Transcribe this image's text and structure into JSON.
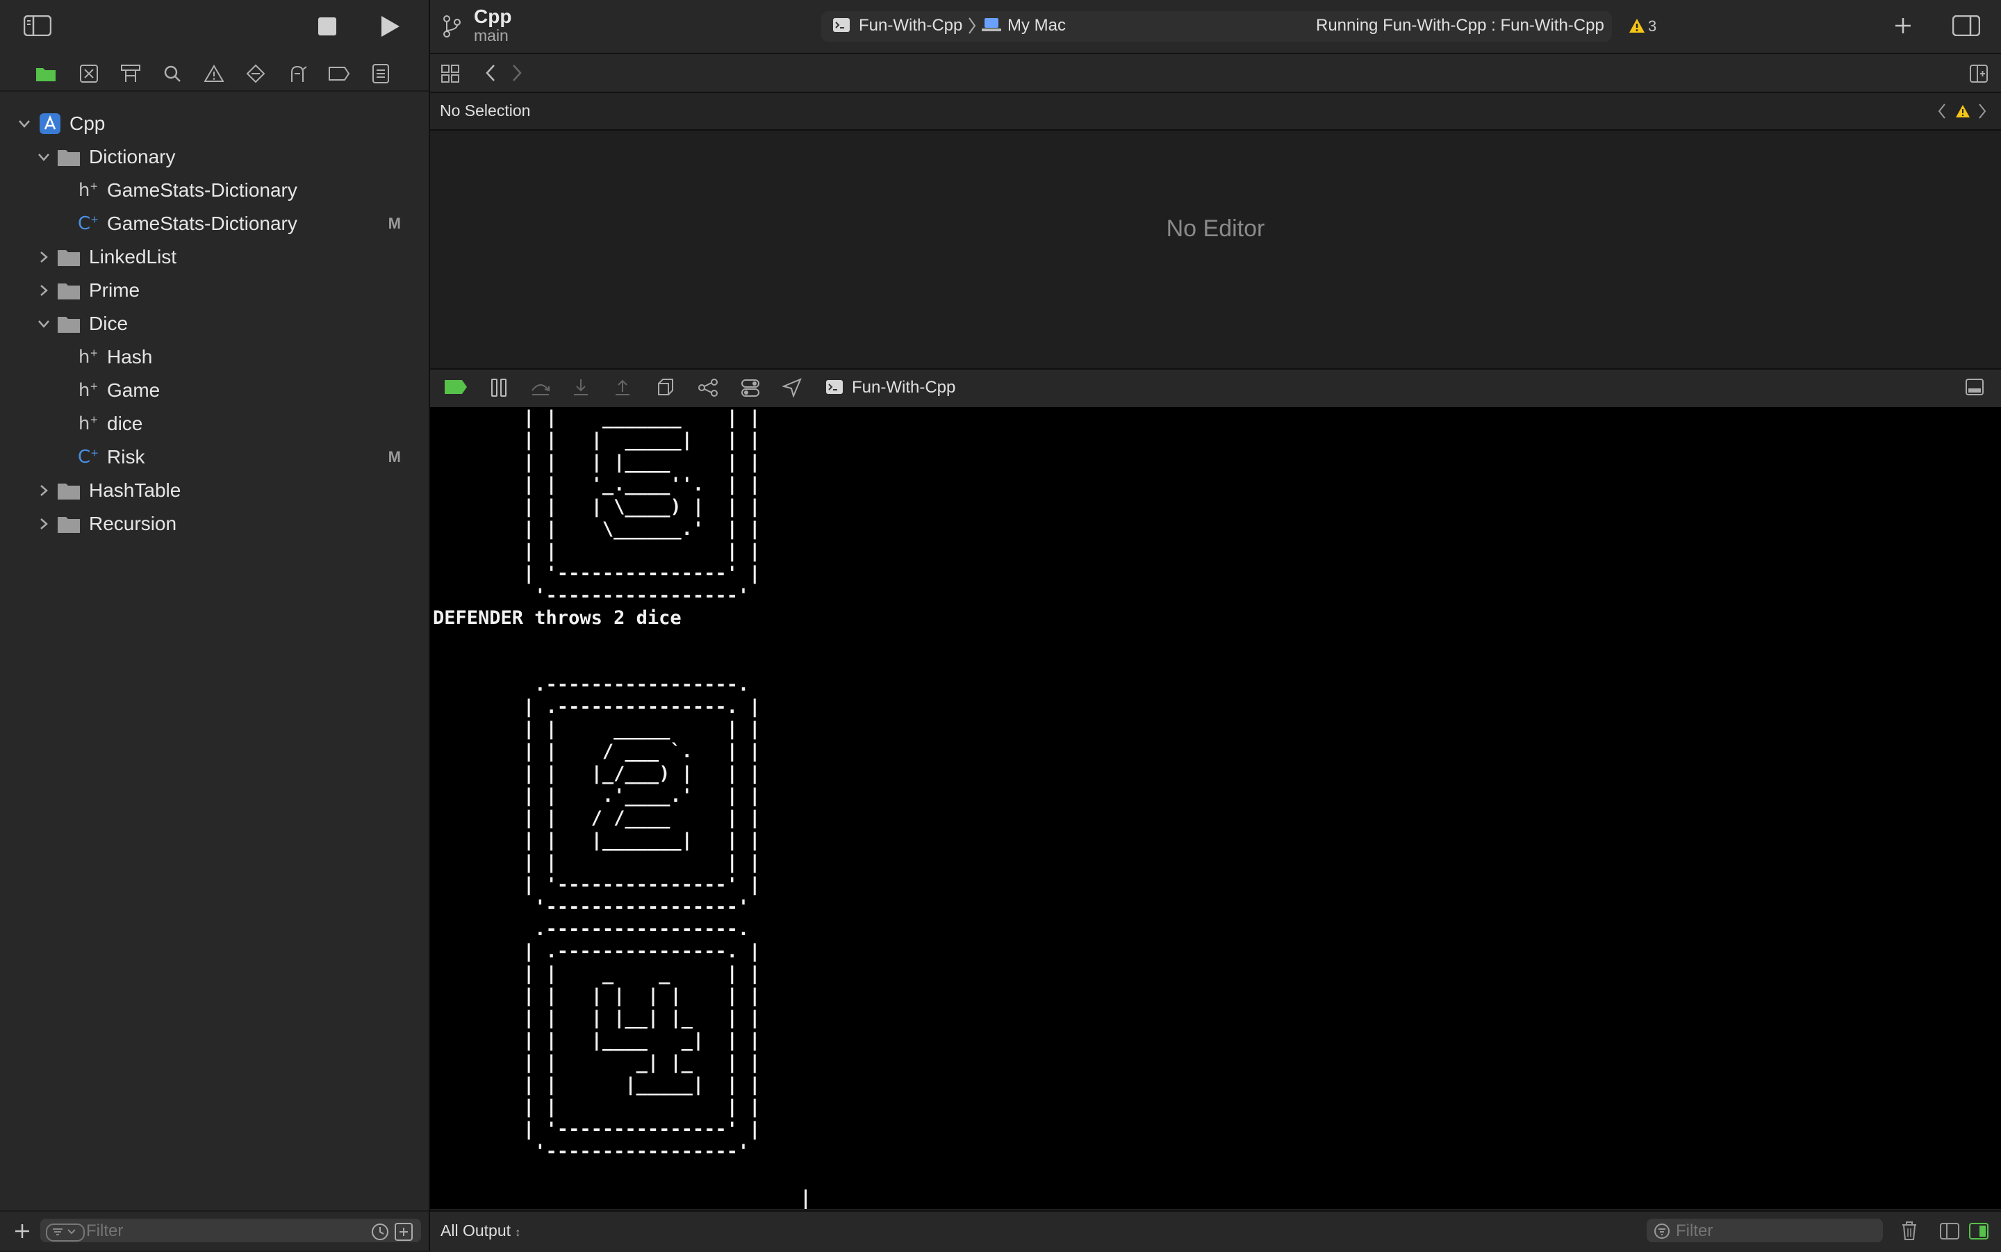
{
  "colors": {
    "accent_green": "#57c24a",
    "file_blue": "#4a90e2",
    "warning": "#f5c518",
    "console_bg": "#000000"
  },
  "toolbar": {
    "project_name": "Cpp",
    "branch": "main",
    "scheme": "Fun-With-Cpp",
    "destination": "My Mac",
    "status": "Running Fun-With-Cpp : Fun-With-Cpp",
    "warning_count": "3",
    "icons": [
      "sidebar-toggle-icon",
      "stop-icon",
      "run-icon",
      "branch-icon",
      "add-icon",
      "inspector-toggle-icon"
    ]
  },
  "navigator_tabs": [
    "folder-icon",
    "source-control-icon",
    "symbol-icon",
    "search-icon",
    "issue-icon",
    "test-icon",
    "debug-icon",
    "breakpoint-icon",
    "report-icon"
  ],
  "tree": {
    "items": [
      {
        "label": "Cpp",
        "type": "project",
        "expanded": true,
        "badge": ""
      },
      {
        "label": "Dictionary",
        "type": "folder",
        "expanded": true,
        "badge": ""
      },
      {
        "label": "GameStats-Dictionary",
        "type": "header",
        "badge": ""
      },
      {
        "label": "GameStats-Dictionary",
        "type": "cpp",
        "badge": "M"
      },
      {
        "label": "LinkedList",
        "type": "folder",
        "expanded": false,
        "badge": ""
      },
      {
        "label": "Prime",
        "type": "folder",
        "expanded": false,
        "badge": ""
      },
      {
        "label": "Dice",
        "type": "folder",
        "expanded": true,
        "badge": ""
      },
      {
        "label": "Hash",
        "type": "header",
        "badge": ""
      },
      {
        "label": "Game",
        "type": "header",
        "badge": ""
      },
      {
        "label": "dice",
        "type": "header",
        "badge": ""
      },
      {
        "label": "Risk",
        "type": "cpp",
        "badge": "M"
      },
      {
        "label": "HashTable",
        "type": "folder",
        "expanded": false,
        "badge": ""
      },
      {
        "label": "Recursion",
        "type": "folder",
        "expanded": false,
        "badge": ""
      }
    ],
    "header_glyph": "h",
    "cpp_glyph": "C",
    "plus_glyph": "+"
  },
  "sidebar_filter": {
    "placeholder": "Filter"
  },
  "editor": {
    "jump_label": "No Selection",
    "empty_label": "No Editor"
  },
  "debug": {
    "process_label": "Fun-With-Cpp"
  },
  "console": {
    "text": "        | |    _______    | |\n        | |   |  _____|   | |\n        | |   | |____     | |\n        | |   '_.____''.  | |\n        | |   | \\____) |  | |\n        | |    \\______.'  | |\n        | |               | |\n        | '---------------' |\n         '-----------------'\nDEFENDER throws 2 dice\n\n\n         .-----------------.\n        | .---------------. |\n        | |     _____     | |\n        | |    / ___ `.   | |\n        | |   |_/___) |   | |\n        | |    .'____.'   | |\n        | |   / /____     | |\n        | |   |_______|   | |\n        | |               | |\n        | '---------------' |\n         '-----------------'\n         .-----------------.\n        | .---------------. |\n        | |    _    _     | |\n        | |   | |  | |    | |\n        | |   | |__| |_   | |\n        | |   |____   _|  | |\n        | |       _| |_   | |\n        | |      |_____|  | |\n        | |               | |\n        | '---------------' |\n         '-----------------'"
  },
  "statusbar": {
    "output_label": "All Output",
    "filter_placeholder": "Filter"
  }
}
